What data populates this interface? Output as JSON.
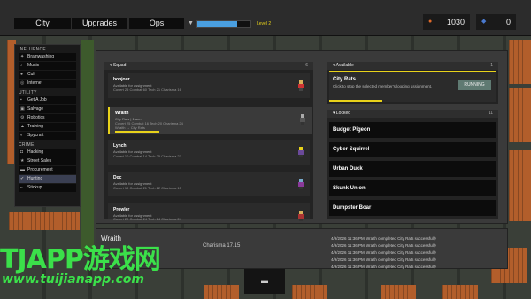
{
  "tabs": [
    "City",
    "Upgrades",
    "Ops"
  ],
  "level_label": "Level 2",
  "level_progress": 0.75,
  "resources": [
    {
      "icon": "cash-icon",
      "value": "1030"
    },
    {
      "icon": "token-icon",
      "value": "0"
    }
  ],
  "sidebar": {
    "sections": [
      {
        "title": "INFLUENCE",
        "items": [
          "Brainwashing",
          "Music",
          "Cult",
          "Internet"
        ]
      },
      {
        "title": "UTILITY",
        "items": [
          "Get A Job",
          "Salvage",
          "Robotics",
          "Training",
          "Spycraft"
        ]
      },
      {
        "title": "CRIME",
        "items": [
          "Hacking",
          "Street Sales",
          "Procurement",
          "Hunting",
          "Stickup"
        ]
      }
    ],
    "active_item": "Hunting"
  },
  "squad": {
    "header": "Squad",
    "count": "6",
    "members": [
      {
        "name": "bonjour",
        "status": "Available for assignment",
        "stats": "Covert 25  Combat 60  Tech 21  Charisma 16",
        "extra": "",
        "selected": false
      },
      {
        "name": "Wraith",
        "status": "City Rats  |  1 ann",
        "stats": "Covert 25  Combat 16  Tech 20  Charisma 24",
        "extra": "Wraith → City Rats",
        "selected": true
      },
      {
        "name": "Lynch",
        "status": "Available for assignment",
        "stats": "Covert 10  Combat 14  Tech 25  Charisma 27",
        "extra": "",
        "selected": false
      },
      {
        "name": "Doc",
        "status": "Available for assignment",
        "stats": "Covert 19  Combat 21  Tech 22  Charisma 15",
        "extra": "",
        "selected": false
      },
      {
        "name": "Prowler",
        "status": "Available for assignment",
        "stats": "Covert 20  Combat 24  Tech 24  Charisma 24",
        "extra": "",
        "selected": false
      }
    ]
  },
  "available": {
    "header": "Available",
    "count": "1",
    "job_title": "City Rats",
    "job_desc": "Click to stop the selected member's looping assignment.",
    "button": "RUNNING"
  },
  "locked": {
    "header": "Locked",
    "count": "11",
    "items": [
      "Budget Pigeon",
      "Cyber Squirrel",
      "Urban Duck",
      "Skunk Union",
      "Dumpster Boar"
    ]
  },
  "log": {
    "member_name": "Wraith",
    "charisma": "Charisma 17.15",
    "entries": [
      "4/9/2026 11:36 PM    Wraith completed City Rats successfully",
      "4/9/2026 11:36 PM    Wraith completed City Rats successfully",
      "4/9/2026 11:36 PM    Wraith completed City Rats successfully",
      "4/9/2026 11:36 PM    Wraith completed City Rats successfully",
      "4/9/2026 11:36 PM    Wraith completed City Rats successfully"
    ]
  },
  "bottom_button": "▬",
  "watermark": {
    "line1": "TJAPP游戏网",
    "line2": "www.tuijianapp.com"
  },
  "colors": {
    "accent": "#e8d21a",
    "progress": "#4a9fe0",
    "running": "#5f7a72"
  }
}
